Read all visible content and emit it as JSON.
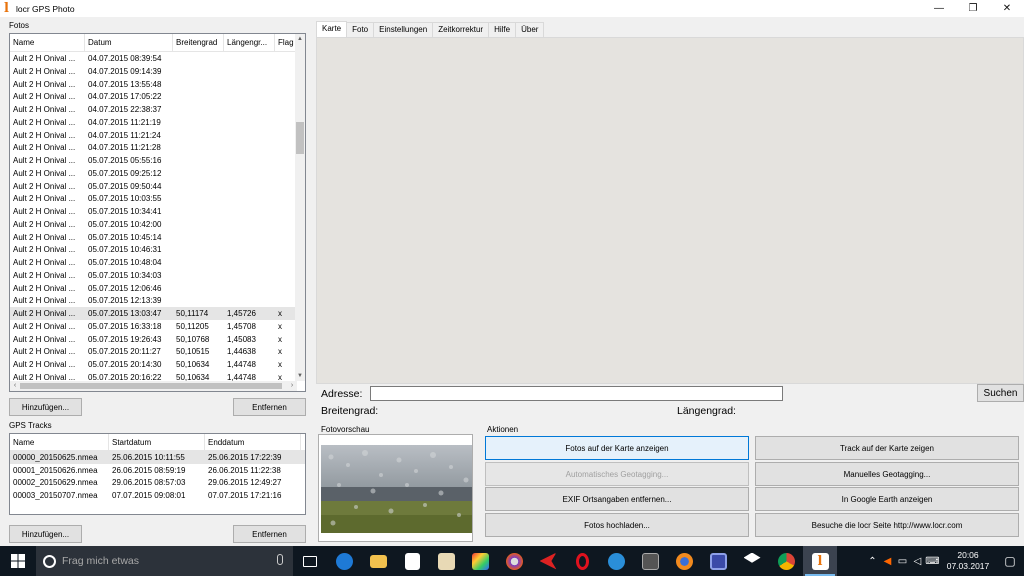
{
  "window": {
    "title": "locr GPS Photo",
    "icon_letter": "l",
    "minimize": "—",
    "restore": "❐",
    "close": "✕"
  },
  "photos_group": {
    "label": "Fotos",
    "columns": [
      "Name",
      "Datum",
      "Breitengrad",
      "Längengr...",
      "Flag"
    ],
    "rows": [
      [
        "Ault 2 H Onival ...",
        "04.07.2015 08:39:54",
        "",
        "",
        ""
      ],
      [
        "Ault 2 H Onival ...",
        "04.07.2015 09:14:39",
        "",
        "",
        ""
      ],
      [
        "Ault 2 H Onival ...",
        "04.07.2015 13:55:48",
        "",
        "",
        ""
      ],
      [
        "Ault 2 H Onival ...",
        "04.07.2015 17:05:22",
        "",
        "",
        ""
      ],
      [
        "Ault 2 H Onival ...",
        "04.07.2015 22:38:37",
        "",
        "",
        ""
      ],
      [
        "Ault 2 H Onival ...",
        "04.07.2015 11:21:19",
        "",
        "",
        ""
      ],
      [
        "Ault 2 H Onival ...",
        "04.07.2015 11:21:24",
        "",
        "",
        ""
      ],
      [
        "Ault 2 H Onival ...",
        "04.07.2015 11:21:28",
        "",
        "",
        ""
      ],
      [
        "Ault 2 H Onival ...",
        "05.07.2015 05:55:16",
        "",
        "",
        ""
      ],
      [
        "Ault 2 H Onival ...",
        "05.07.2015 09:25:12",
        "",
        "",
        ""
      ],
      [
        "Ault 2 H Onival ...",
        "05.07.2015 09:50:44",
        "",
        "",
        ""
      ],
      [
        "Ault 2 H Onival ...",
        "05.07.2015 10:03:55",
        "",
        "",
        ""
      ],
      [
        "Ault 2 H Onival ...",
        "05.07.2015 10:34:41",
        "",
        "",
        ""
      ],
      [
        "Ault 2 H Onival ...",
        "05.07.2015 10:42:00",
        "",
        "",
        ""
      ],
      [
        "Ault 2 H Onival ...",
        "05.07.2015 10:45:14",
        "",
        "",
        ""
      ],
      [
        "Ault 2 H Onival ...",
        "05.07.2015 10:46:31",
        "",
        "",
        ""
      ],
      [
        "Ault 2 H Onival ...",
        "05.07.2015 10:48:04",
        "",
        "",
        ""
      ],
      [
        "Ault 2 H Onival ...",
        "05.07.2015 10:34:03",
        "",
        "",
        ""
      ],
      [
        "Ault 2 H Onival ...",
        "05.07.2015 12:06:46",
        "",
        "",
        ""
      ],
      [
        "Ault 2 H Onival ...",
        "05.07.2015 12:13:39",
        "",
        "",
        ""
      ],
      [
        "Ault 2 H Onival ...",
        "05.07.2015 13:03:47",
        "50,11174",
        "1,45726",
        "x"
      ],
      [
        "Ault 2 H Onival ...",
        "05.07.2015 16:33:18",
        "50,11205",
        "1,45708",
        "x"
      ],
      [
        "Ault 2 H Onival ...",
        "05.07.2015 19:26:43",
        "50,10768",
        "1,45083",
        "x"
      ],
      [
        "Ault 2 H Onival ...",
        "05.07.2015 20:11:27",
        "50,10515",
        "1,44638",
        "x"
      ],
      [
        "Ault 2 H Onival ...",
        "05.07.2015 20:14:30",
        "50,10634",
        "1,44748",
        "x"
      ],
      [
        "Ault 2 H Onival ...",
        "05.07.2015 20:16:22",
        "50,10634",
        "1,44748",
        "x"
      ]
    ],
    "selected_row": 20,
    "add_button": "Hinzufügen...",
    "remove_button": "Entfernen"
  },
  "tracks_group": {
    "label": "GPS Tracks",
    "columns": [
      "Name",
      "Startdatum",
      "Enddatum"
    ],
    "rows": [
      [
        "00000_20150625.nmea",
        "25.06.2015 10:11:55",
        "25.06.2015 17:22:39"
      ],
      [
        "00001_20150626.nmea",
        "26.06.2015 08:59:19",
        "26.06.2015 11:22:38"
      ],
      [
        "00002_20150629.nmea",
        "29.06.2015 08:57:03",
        "29.06.2015 12:49:27"
      ],
      [
        "00003_20150707.nmea",
        "07.07.2015 09:08:01",
        "07.07.2015 17:21:16"
      ]
    ],
    "selected_row": 0,
    "add_button": "Hinzufügen...",
    "remove_button": "Entfernen"
  },
  "tabs": [
    "Karte",
    "Foto",
    "Einstellungen",
    "Zeitkorrektur",
    "Hilfe",
    "Über"
  ],
  "active_tab": 0,
  "address": {
    "label": "Adresse:",
    "value": "",
    "search_button": "Suchen"
  },
  "coords": {
    "lat_label": "Breitengrad:",
    "lon_label": "Längengrad:"
  },
  "preview": {
    "label": "Fotovorschau"
  },
  "actions": {
    "label": "Aktionen",
    "show_photos": "Fotos auf der Karte anzeigen",
    "show_track": "Track auf der Karte zeigen",
    "auto_geotag": "Automatisches Geotagging...",
    "manual_geotag": "Manuelles Geotagging...",
    "remove_exif": "EXIF Ortsangaben entfernen...",
    "google_earth": "In Google Earth anzeigen",
    "upload": "Fotos hochladen...",
    "visit_site": "Besuche die locr Seite  http://www.locr.com"
  },
  "taskbar": {
    "search_placeholder": "Frag mich etwas",
    "time": "20:06",
    "date": "07.03.2017"
  }
}
